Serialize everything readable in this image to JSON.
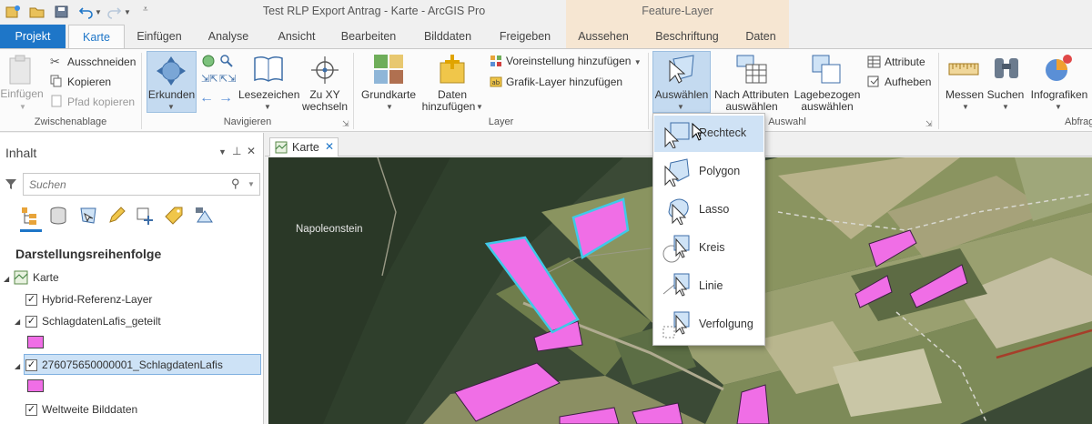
{
  "window": {
    "title": "Test RLP Export Antrag - Karte - ArcGIS Pro",
    "context_title": "Feature-Layer"
  },
  "tabs": {
    "projekt": "Projekt",
    "karte": "Karte",
    "einfuegen": "Einfügen",
    "analyse": "Analyse",
    "ansicht": "Ansicht",
    "bearbeiten": "Bearbeiten",
    "bilddaten": "Bilddaten",
    "freigeben": "Freigeben",
    "aussehen": "Aussehen",
    "beschriftung": "Beschriftung",
    "daten": "Daten"
  },
  "ribbon": {
    "zwischenablage": {
      "label": "Zwischenablage",
      "einfuegen": "Einfügen",
      "ausschneiden": "Ausschneiden",
      "kopieren": "Kopieren",
      "pfad_kopieren": "Pfad kopieren"
    },
    "navigieren": {
      "label": "Navigieren",
      "erkunden": "Erkunden",
      "lesezeichen": "Lesezeichen",
      "zu_xy_1": "Zu XY",
      "zu_xy_2": "wechseln"
    },
    "layer": {
      "label": "Layer",
      "grundkarte": "Grundkarte",
      "daten_1": "Daten",
      "daten_2": "hinzufügen",
      "voreinstellung": "Voreinstellung hinzufügen",
      "grafik_layer": "Grafik-Layer hinzufügen"
    },
    "auswahl": {
      "label": "Auswahl",
      "auswaehlen": "Auswählen",
      "nach_attributen_1": "Nach Attributen",
      "nach_attributen_2": "auswählen",
      "lagebezogen_1": "Lagebezogen",
      "lagebezogen_2": "auswählen",
      "attribute": "Attribute",
      "aufheben": "Aufheben"
    },
    "abfrage": {
      "label": "Abfrage",
      "messen": "Messen",
      "suchen": "Suchen",
      "infografiken": "Infografiken"
    }
  },
  "contents": {
    "title": "Inhalt",
    "search_placeholder": "Suchen",
    "drawing_order": "Darstellungsreihenfolge",
    "layers": {
      "map": "Karte",
      "hybrid": "Hybrid-Referenz-Layer",
      "schlag_geteilt": "SchlagdatenLafis_geteilt",
      "lafis": "276075650000001_SchlagdatenLafis",
      "weltweit": "Weltweite Bilddaten"
    }
  },
  "map": {
    "tab": "Karte",
    "place_label": "Napoleonstein"
  },
  "select_menu": {
    "items": [
      "Rechteck",
      "Polygon",
      "Lasso",
      "Kreis",
      "Linie",
      "Verfolgung"
    ]
  },
  "colors": {
    "accent": "#1e76c8",
    "feature_fill": "#f06ee6",
    "selection_outline": "#3fc9e8",
    "context_band": "#f6e6d2"
  }
}
